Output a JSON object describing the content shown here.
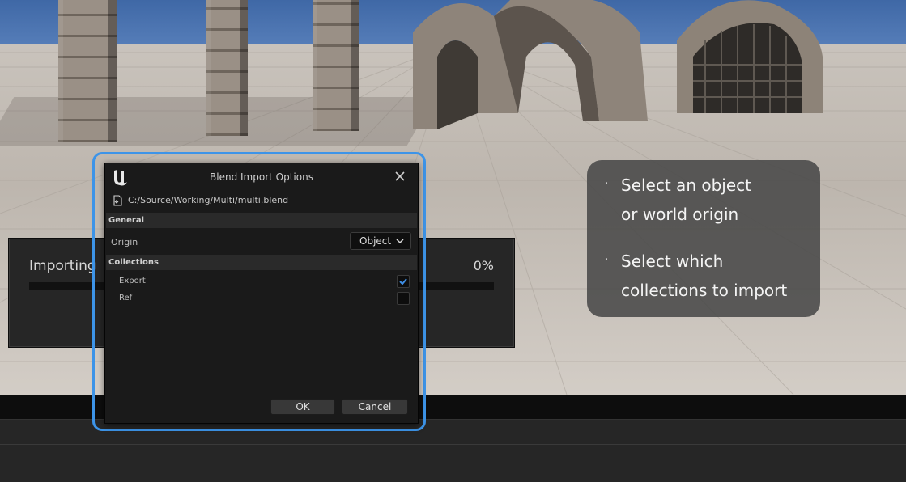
{
  "progress_window": {
    "label": "Importing",
    "percent_text": "0%",
    "progress_value": 0
  },
  "dialog": {
    "title": "Blend Import Options",
    "logo": "ue-logo-icon",
    "file_path": "C:/Source/Working/Multi/multi.blend",
    "sections": {
      "general": "General",
      "collections": "Collections"
    },
    "origin": {
      "label": "Origin",
      "value": "Object"
    },
    "collections": [
      {
        "label": "Export",
        "checked": true
      },
      {
        "label": "Ref",
        "checked": false
      }
    ],
    "ok_label": "OK",
    "cancel_label": "Cancel"
  },
  "callout": {
    "bullet": "·",
    "lines": [
      "Select an object",
      "or world origin",
      "Select which",
      "collections to import"
    ]
  },
  "colors": {
    "highlight": "#3d94e8",
    "checkmark": "#3f8fe6",
    "dialog_bg": "#1a1a1a"
  }
}
